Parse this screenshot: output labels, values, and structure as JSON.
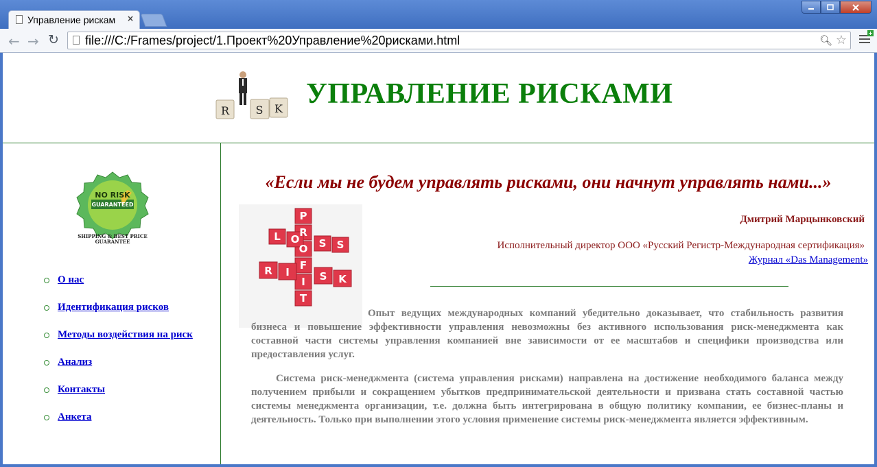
{
  "browser": {
    "tab_title": "Управление рискам",
    "tab_close": "×",
    "url": "file:///C:/Frames/project/1.Проект%20Управление%20рисками.html",
    "window_buttons": [
      "minimize",
      "maximize",
      "close"
    ]
  },
  "header": {
    "logo_tiles": [
      "R",
      "S",
      "K"
    ],
    "title": "УПРАВЛЕНИЕ РИСКАМИ"
  },
  "sidebar": {
    "badge_top": "NO RISK",
    "badge_bottom": "GUARANTEED",
    "badge_caption_1": "SHIPPING & BEST PRICE",
    "badge_caption_2": "GUARANTEE",
    "nav": [
      {
        "label": "О нас"
      },
      {
        "label": "Идентификация рисков"
      },
      {
        "label": "Методы воздействия на риск"
      },
      {
        "label": "Анализ"
      },
      {
        "label": "Контакты"
      },
      {
        "label": "Анкета"
      }
    ]
  },
  "content": {
    "quote": "«Если мы не будем управлять рисками, они начнут управлять нами...»",
    "puzzle_words": [
      "PROFIT",
      "LOSS",
      "RISK"
    ],
    "author": "Дмитрий Марцынковский",
    "author_role": "Исполнительный директор ООО «Русский Регистр-Международная сертификация»",
    "journal_link": "Журнал «Das Management»",
    "paragraph1": "Опыт ведущих международных компаний убедительно доказывает, что стабильность развития бизнеса и повышение эффективности управления невозможны без активного использования риск-менеджмента как составной части системы управления компанией вне зависимости от ее масштабов и специфики производства или предоставления услуг.",
    "paragraph2": "Система риск-менеджмента (система управления рисками) направлена на достижение необходимого баланса между получением прибыли и сокращением убытков предпринимательской деятельности и призвана стать составной частью системы менеджмента организации, т.е. должна быть интегрирована в общую политику компании, ее бизнес-планы и деятельность. Только при выполнении этого условия применение системы риск-менеджмента является эффективным."
  },
  "colors": {
    "title_green": "#0b7f0b",
    "quote_red": "#8b0000",
    "link_blue": "#0000d0",
    "body_gray": "#7b7b7b"
  }
}
